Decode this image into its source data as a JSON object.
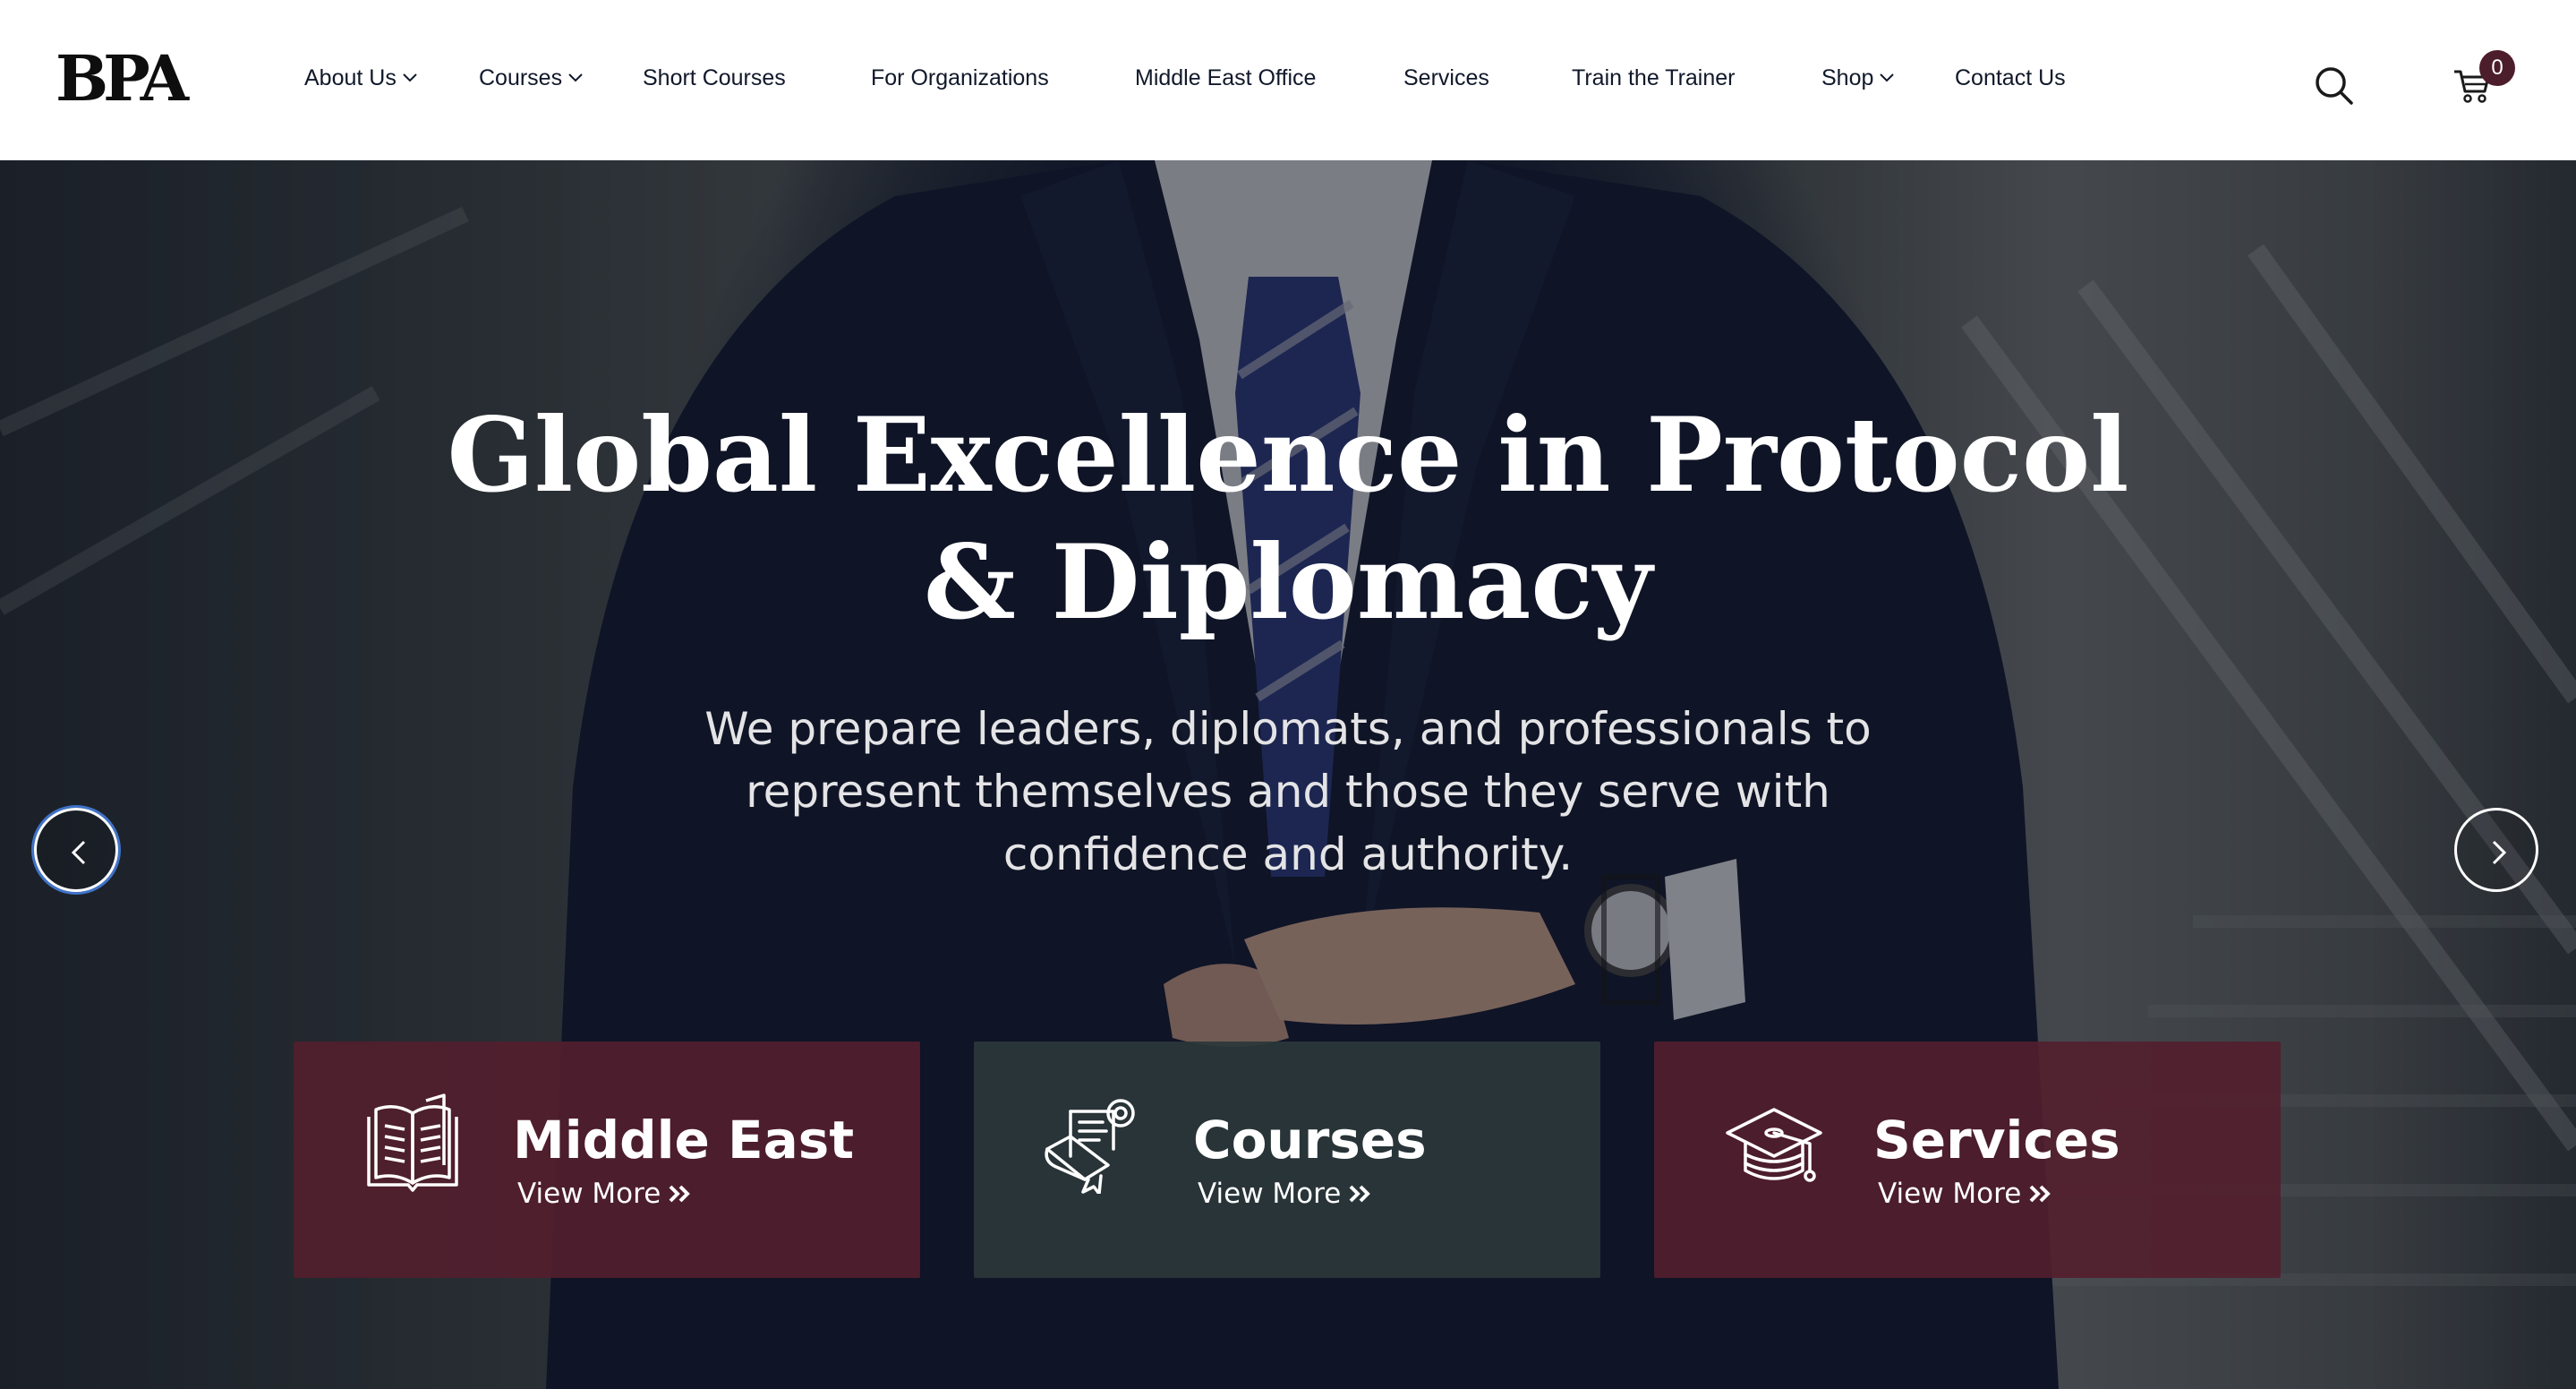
{
  "header": {
    "logo": "BPA",
    "nav": [
      {
        "label": "About Us",
        "has_dropdown": true
      },
      {
        "label": "Courses",
        "has_dropdown": true
      },
      {
        "label": "Short Courses",
        "has_dropdown": false
      },
      {
        "label": "For Organizations",
        "has_dropdown": false
      },
      {
        "label": "Middle East Office",
        "has_dropdown": false
      },
      {
        "label": "Services",
        "has_dropdown": false
      },
      {
        "label": "Train the Trainer",
        "has_dropdown": false
      },
      {
        "label": "Shop",
        "has_dropdown": true
      },
      {
        "label": "Contact Us",
        "has_dropdown": false
      }
    ],
    "search_icon": "search-icon",
    "cart_icon": "cart-icon",
    "cart_count": "0"
  },
  "hero": {
    "title": "Global Excellence in Protocol & Diplomacy",
    "subtitle": "We prepare leaders, diplomats, and professionals to represent themselves and those they serve with confidence and authority.",
    "prev_icon": "chevron-left-icon",
    "next_icon": "chevron-right-icon"
  },
  "cards": [
    {
      "title": "Middle East",
      "link": "View More",
      "icon": "open-book-icon",
      "color": "#531e2d"
    },
    {
      "title": "Courses",
      "link": "View More",
      "icon": "certificate-icon",
      "color": "#2a373a"
    },
    {
      "title": "Services",
      "link": "View More",
      "icon": "graduation-cap-icon",
      "color": "#531e2d"
    }
  ],
  "colors": {
    "accent_maroon": "#4c1d2b",
    "card_maroon": "#531e2d",
    "card_slate": "#2a373a",
    "header_bg": "#ffffff",
    "nav_text": "#10182a"
  }
}
